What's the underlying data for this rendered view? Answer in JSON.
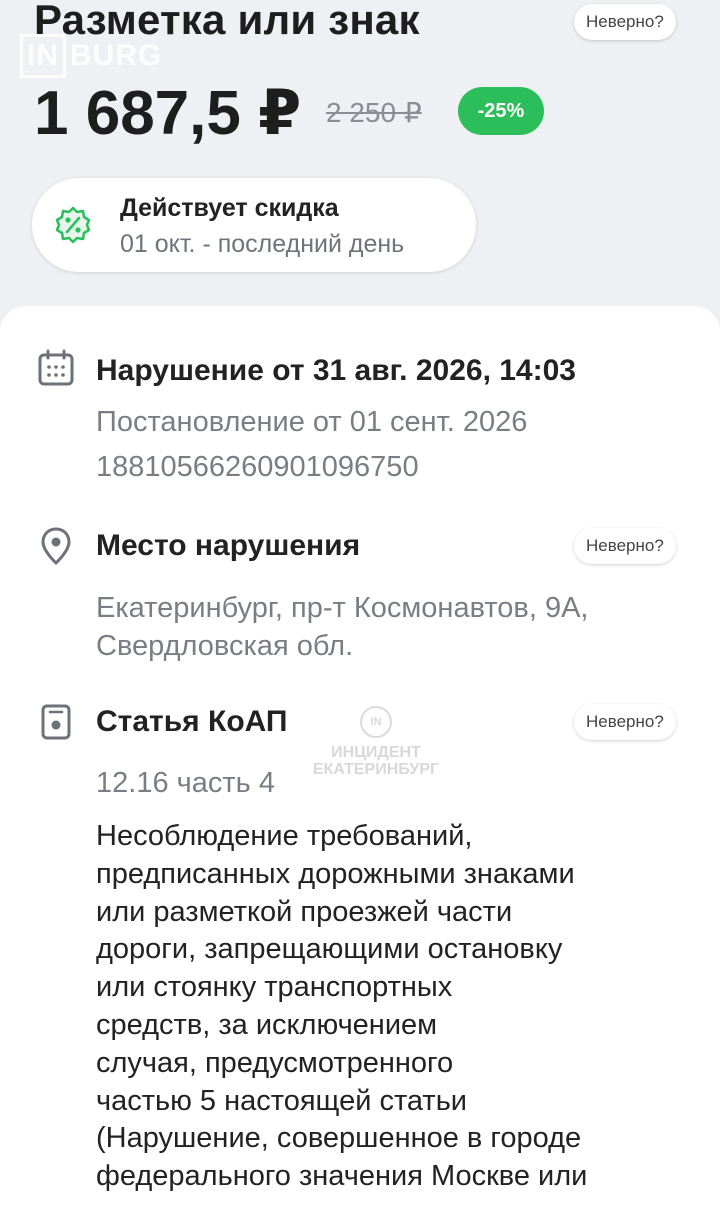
{
  "header": {
    "title": "Разметка или знак",
    "watermark": "IN BURG",
    "wrong_chip": "Неверно?"
  },
  "price": {
    "current": "1 687,5 ₽",
    "old": "2 250 ₽",
    "discount_badge": "-25%",
    "accent_color": "#2dbe5c"
  },
  "promo": {
    "title": "Действует скидка",
    "subtitle": "01 окт. - последний день",
    "icon": "percent-badge-icon"
  },
  "violation": {
    "heading": "Нарушение от 31 авг. 2026, 14:03",
    "resolution": "Постановление от 01 сент. 2026",
    "number": "18810566260901096750",
    "icon": "calendar-icon"
  },
  "location": {
    "heading": "Место нарушения",
    "wrong_chip": "Неверно?",
    "line1": "Екатеринбург, пр-т Космонавтов, 9А,",
    "line2": "Свердловская обл.",
    "icon": "location-pin-icon"
  },
  "article": {
    "heading": "Статья КоАП",
    "wrong_chip": "Неверно?",
    "code": "12.16 часть 4",
    "icon": "document-icon",
    "description_lines": [
      "Несоблюдение требований,",
      "предписанных дорожными знаками",
      "или разметкой проезжей части",
      "дороги, запрещающими остановку",
      "или стоянку транспортных",
      "средств, за исключением",
      "случая, предусмотренного",
      "частью 5 настоящей статьи",
      "(Нарушение, совершенное в городе",
      "федерального значения Москве или"
    ]
  },
  "watermark_mid": {
    "line1": "ИНЦИДЕНТ",
    "line2": "ЕКАТЕРИНБУРГ",
    "logo": "IN"
  }
}
